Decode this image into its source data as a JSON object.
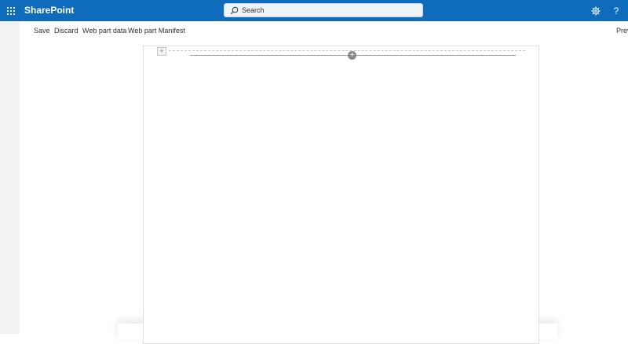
{
  "suite_bar": {
    "app_name": "SharePoint",
    "search": {
      "placeholder": "Search",
      "value": ""
    },
    "help_label": "?"
  },
  "command_bar": {
    "save": "Save",
    "discard": "Discard",
    "web_part_data": "Web part data",
    "web_part_manifest": "Web part Manifest",
    "preview_partial": "Prev"
  },
  "canvas": {
    "section_add_glyph": "+",
    "webpart_add_glyph": "+"
  },
  "colors": {
    "suite_bar": "#0f6cbd",
    "left_rail": "#f3f2f1",
    "text": "#323130"
  },
  "icons": {
    "waffle": "app-launcher-icon",
    "search": "search-icon",
    "settings": "gear-icon",
    "help": "question-mark-icon",
    "add": "plus-icon"
  }
}
